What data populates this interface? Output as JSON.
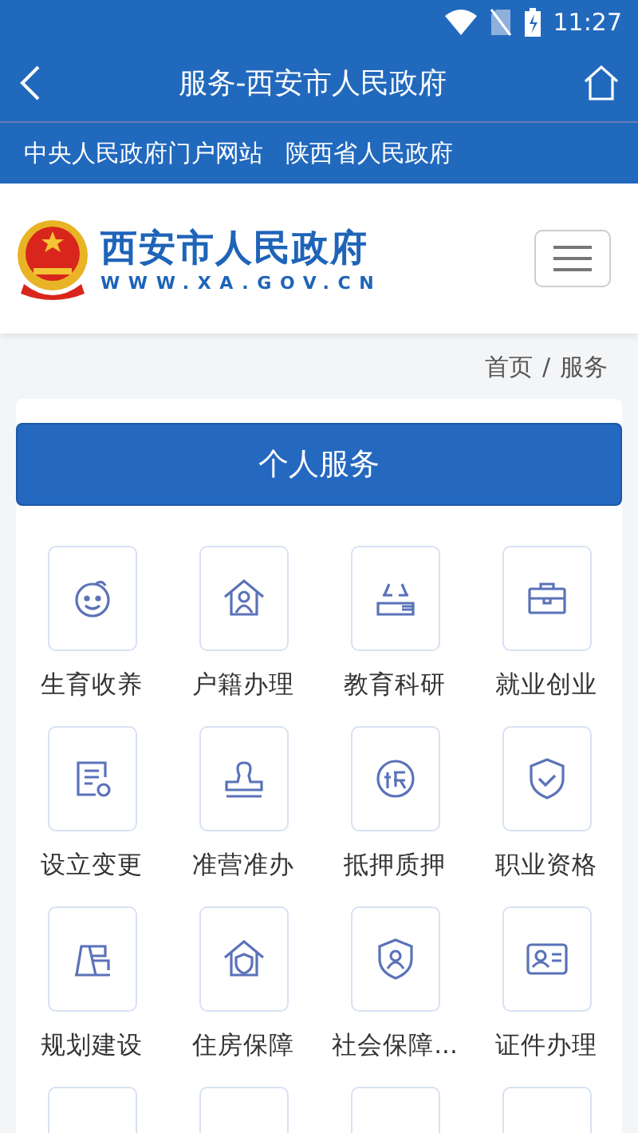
{
  "status_bar": {
    "time": "11:27"
  },
  "title_bar": {
    "title": "服务-西安市人民政府"
  },
  "links": [
    "中央人民政府门户网站",
    "陕西省人民政府"
  ],
  "site_header": {
    "name": "西安市人民政府",
    "url": "WWW.XA.GOV.CN"
  },
  "breadcrumb": {
    "home": "首页",
    "separator": "/",
    "current": "服务"
  },
  "section": {
    "title": "个人服务"
  },
  "services": [
    {
      "label": "生育收养"
    },
    {
      "label": "户籍办理"
    },
    {
      "label": "教育科研"
    },
    {
      "label": "就业创业"
    },
    {
      "label": "设立变更"
    },
    {
      "label": "准营准办"
    },
    {
      "label": "抵押质押"
    },
    {
      "label": "职业资格"
    },
    {
      "label": "规划建设"
    },
    {
      "label": "住房保障"
    },
    {
      "label": "社会保障..."
    },
    {
      "label": "证件办理"
    }
  ]
}
